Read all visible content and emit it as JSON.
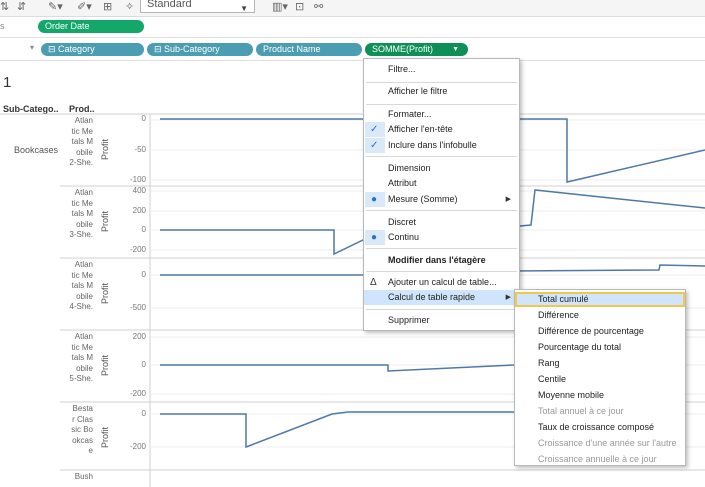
{
  "toolbar": {
    "fit_select": "Standard"
  },
  "shelves": {
    "columns_pill": "Order Date",
    "row_pills": [
      "Category",
      "Sub-Category",
      "Product Name"
    ],
    "measure_pill": "SOMME(Profit)"
  },
  "sheet": {
    "title": "1",
    "col_sub_category": "Sub-Catego..",
    "col_product": "Prod..",
    "sub_category_value": "Bookcases",
    "axis_label": "Profit"
  },
  "panes": [
    {
      "product": [
        "Atlan",
        "tic Me",
        "tals M",
        "obile",
        "2-She."
      ],
      "ticks": [
        "0",
        "-50",
        "-100"
      ]
    },
    {
      "product": [
        "Atlan",
        "tic Me",
        "tals M",
        "obile",
        "3-She."
      ],
      "ticks": [
        "400",
        "200",
        "0",
        "-200"
      ]
    },
    {
      "product": [
        "Atlan",
        "tic Me",
        "tals M",
        "obile",
        "4-She."
      ],
      "ticks": [
        "0",
        "-500"
      ]
    },
    {
      "product": [
        "Atlan",
        "tic Me",
        "tals M",
        "obile",
        "5-She."
      ],
      "ticks": [
        "200",
        "0",
        "-200"
      ]
    },
    {
      "product": [
        "Besta",
        "r Clas",
        "sic Bo",
        "okcas",
        "e"
      ],
      "ticks": [
        "0",
        "-200"
      ]
    },
    {
      "product": [
        "Bush"
      ],
      "ticks": []
    }
  ],
  "context_menu": {
    "items": [
      "Filtre...",
      "Afficher le filtre",
      "Formater...",
      "Afficher l'en-tête",
      "Inclure dans l'infobulle",
      "Dimension",
      "Attribut",
      "Mesure (Somme)",
      "Discret",
      "Continu",
      "Modifier dans l'étagère",
      "Ajouter un calcul de table...",
      "Calcul de table rapide",
      "Supprimer"
    ]
  },
  "submenu": {
    "items": [
      "Total cumulé",
      "Différence",
      "Différence de pourcentage",
      "Pourcentage du total",
      "Rang",
      "Centile",
      "Moyenne mobile",
      "Total annuel à ce jour",
      "Taux de croissance composé",
      "Croissance d'une année sur l'autre",
      "Croissance annuelle à ce jour"
    ]
  },
  "colors": {
    "pill_blue": "#4b9db2",
    "pill_green": "#13a86a",
    "line": "#4e79a7",
    "menu_highlight": "#cfe5fb",
    "focus_outline": "#f2c84b"
  }
}
